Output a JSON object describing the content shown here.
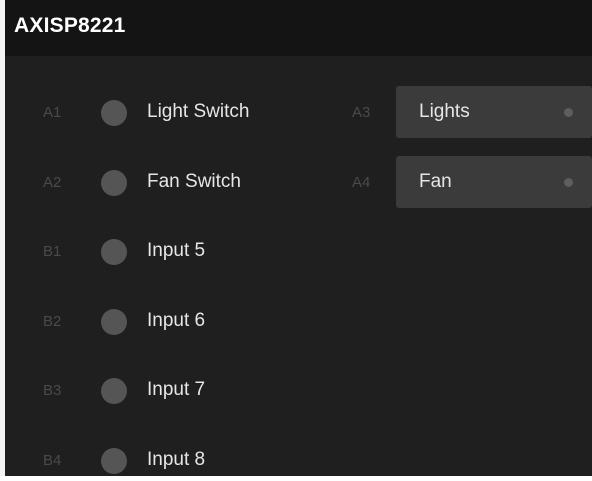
{
  "device": {
    "title": "AXISP8221"
  },
  "inputs": [
    {
      "port": "A1",
      "label": "Light Switch"
    },
    {
      "port": "A2",
      "label": "Fan Switch"
    },
    {
      "port": "B1",
      "label": "Input 5"
    },
    {
      "port": "B2",
      "label": "Input 6"
    },
    {
      "port": "B3",
      "label": "Input 7"
    },
    {
      "port": "B4",
      "label": "Input 8"
    }
  ],
  "outputs": [
    {
      "port": "A3",
      "label": "Lights"
    },
    {
      "port": "A4",
      "label": "Fan"
    }
  ],
  "colors": {
    "panel_background": "#1f1f1f",
    "title_background": "#141414",
    "led_off": "#555555",
    "output_button": "#3b3b3b",
    "port_label": "#4a4a4a",
    "text": "#e6e6e6"
  }
}
